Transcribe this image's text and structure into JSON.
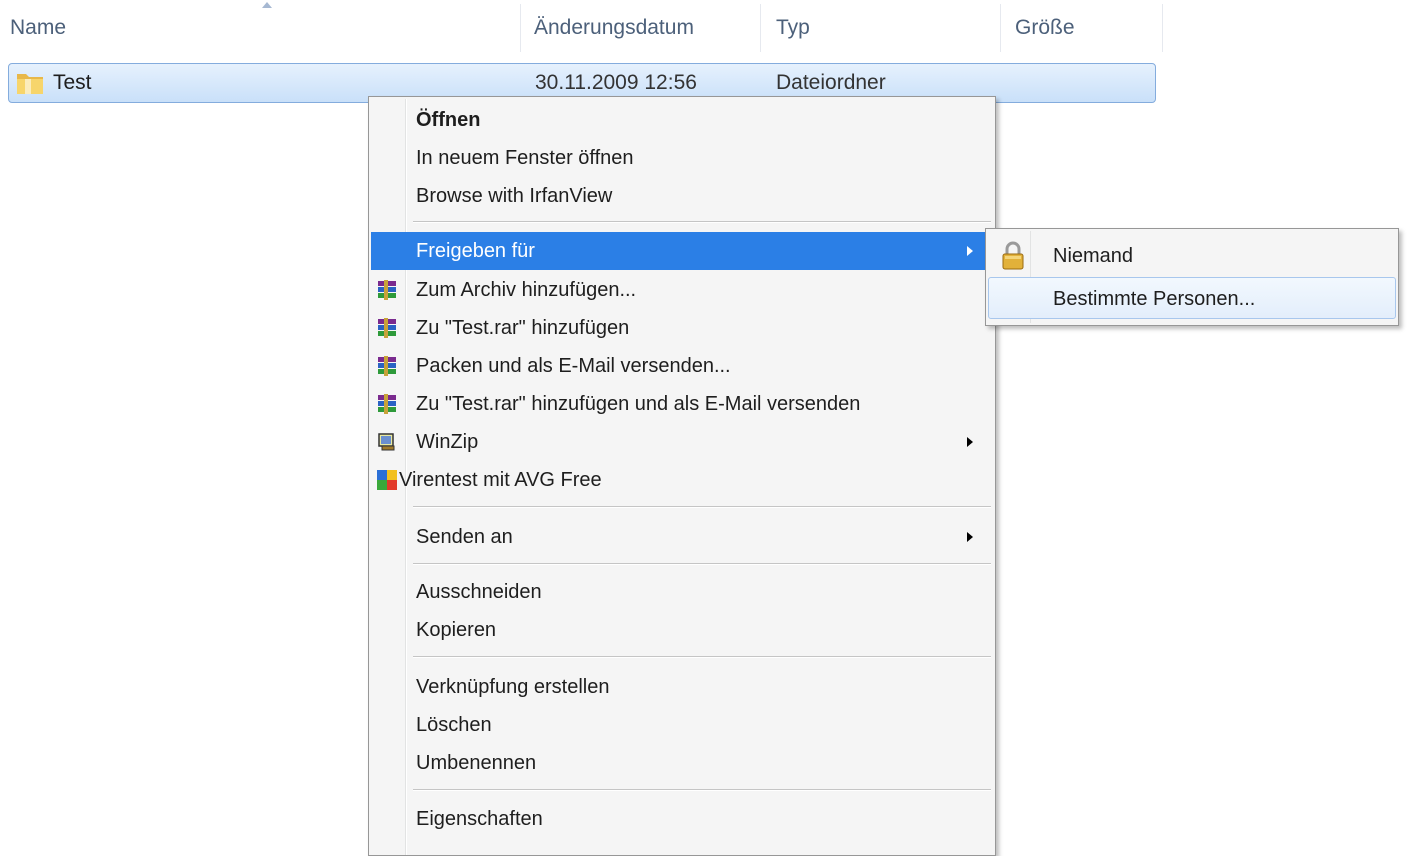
{
  "columns": {
    "name": "Name",
    "modified": "Änderungsdatum",
    "type": "Typ",
    "size": "Größe"
  },
  "file": {
    "name": "Test",
    "modified": "30.11.2009 12:56",
    "type": "Dateiordner",
    "icon": "folder-icon"
  },
  "menu": {
    "open": "Öffnen",
    "open_new_window": "In neuem Fenster öffnen",
    "browse_irfanview": "Browse with IrfanView",
    "share_with": "Freigeben für",
    "add_archive": "Zum Archiv hinzufügen...",
    "add_test_rar": "Zu \"Test.rar\" hinzufügen",
    "pack_email": "Packen und als E-Mail versenden...",
    "add_rar_email": "Zu \"Test.rar\" hinzufügen und als E-Mail versenden",
    "winzip": "WinZip",
    "avg": "Virentest mit AVG Free",
    "send_to": "Senden an",
    "cut": "Ausschneiden",
    "copy": "Kopieren",
    "create_shortcut": "Verknüpfung erstellen",
    "delete": "Löschen",
    "rename": "Umbenennen",
    "properties": "Eigenschaften"
  },
  "submenu": {
    "nobody": "Niemand",
    "specific_people": "Bestimmte Personen..."
  },
  "colors": {
    "highlight": "#2b7fe6",
    "selection": "#c9e0f9",
    "header_text": "#4c607a"
  }
}
